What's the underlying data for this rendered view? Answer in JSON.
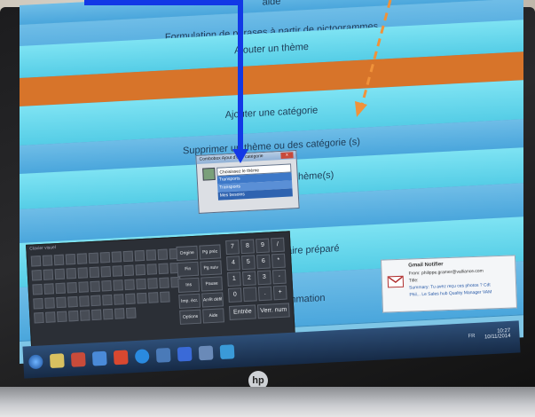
{
  "screen": {
    "bands": [
      {
        "label": "aide",
        "style": "b-blue"
      },
      {
        "label": "Formulation de phrases à partir de pictogrammes",
        "style": "b-blue"
      },
      {
        "label": "Ajouter un thème",
        "style": "b-cyan"
      },
      {
        "label": "",
        "style": "b-orange"
      },
      {
        "label": "Ajouter une catégorie",
        "style": "b-cyan"
      },
      {
        "label": "Supprimer un thème ou des catégorie (s)",
        "style": "b-blue"
      },
      {
        "label": "Supprimer un (des) thème(s)",
        "style": "b-cyan"
      },
      {
        "label": "",
        "style": "b-blue"
      },
      {
        "label": "Créer un questionnaire préparé",
        "style": "b-cyan"
      },
      {
        "label": "Aide à la Programmation",
        "style": "b-blue"
      }
    ]
  },
  "dialog": {
    "title": "Combobox Ajout d'une catégorie",
    "close": "x",
    "select_value": "Choisissez le thème",
    "options": [
      "Transports",
      "Transports",
      "Mes besoins"
    ]
  },
  "keyboard": {
    "title": "Clavier visuel",
    "nav_keys": [
      {
        "label": "Origine"
      },
      {
        "label": "Pg préc"
      },
      {
        "label": "Fin"
      },
      {
        "label": "Pg suiv"
      },
      {
        "label": "Ins"
      },
      {
        "label": "Pause"
      },
      {
        "label": "Imp. écr."
      },
      {
        "label": "Arrêt défil"
      },
      {
        "label": "Options"
      },
      {
        "label": "Aide"
      }
    ],
    "numpad": [
      "7",
      "8",
      "9",
      "/",
      "4",
      "5",
      "6",
      "*",
      "1",
      "2",
      "3",
      "-",
      "0",
      "",
      ".",
      "+"
    ],
    "entree": "Entrée",
    "ver_num": "Verr. num"
  },
  "notification": {
    "title": "Gmail Notifier",
    "from": "From: philippe.gramer@valliance.com",
    "subject": "Title:",
    "summary": "Summary: Tu avez reçu ces photos ? Cdt",
    "signature": "Phil... Le Sales hub Quality Manager VAM"
  },
  "taskbar": {
    "time": "10:27",
    "date": "10/11/2014",
    "tray": "FR"
  },
  "laptop": {
    "brand": "hp"
  },
  "colors": {
    "blue_arrow": "#1238e6",
    "orange_arrow": "#f0923a",
    "band_orange": "#d7742a"
  }
}
